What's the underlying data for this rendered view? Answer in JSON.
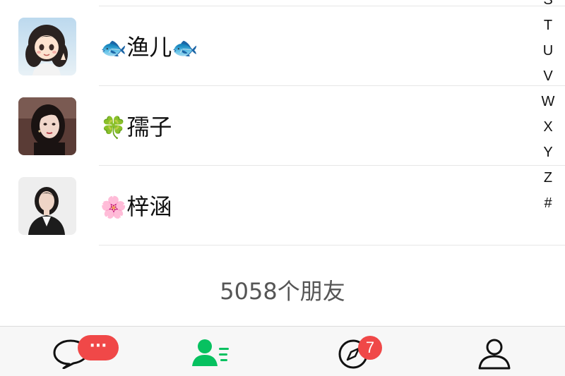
{
  "contacts": [
    {
      "name": "渔儿",
      "prefix_emoji": "🐟",
      "suffix_emoji": "🐟"
    },
    {
      "name": "孺子",
      "prefix_emoji": "🍀",
      "suffix_emoji": ""
    },
    {
      "name": "梓涵",
      "prefix_emoji": "🌸",
      "suffix_emoji": ""
    }
  ],
  "index_letters": [
    "S",
    "T",
    "U",
    "V",
    "W",
    "X",
    "Y",
    "Z",
    "#"
  ],
  "friend_count": "5058个朋友",
  "tab_bar": {
    "chats_badge": "···",
    "discover_badge": "7"
  },
  "colors": {
    "accent_green": "#07c160",
    "badge_red": "#f04848"
  },
  "icons": {
    "chats": "speech-bubble-icon",
    "contacts": "contacts-icon",
    "discover": "compass-icon",
    "me": "person-icon"
  }
}
